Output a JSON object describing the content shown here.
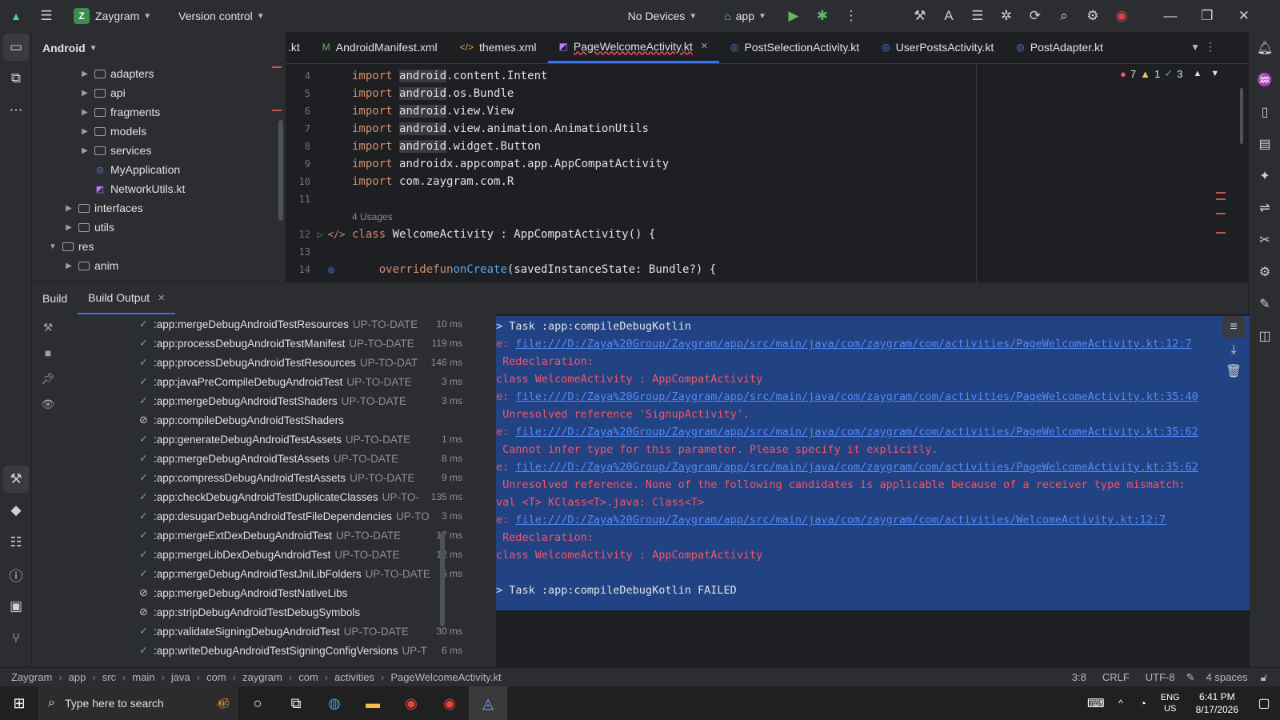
{
  "titlebar": {
    "project_letter": "Z",
    "project_name": "Zaygram",
    "vcs": "Version control",
    "devices": "No Devices",
    "run_config": "app"
  },
  "project_panel": {
    "title": "Android",
    "items": [
      {
        "label": "adapters",
        "indent": 3,
        "kind": "folder",
        "expandable": true
      },
      {
        "label": "api",
        "indent": 3,
        "kind": "folder",
        "expandable": true
      },
      {
        "label": "fragments",
        "indent": 3,
        "kind": "folder",
        "expandable": true
      },
      {
        "label": "models",
        "indent": 3,
        "kind": "folder",
        "expandable": true
      },
      {
        "label": "services",
        "indent": 3,
        "kind": "folder",
        "expandable": true
      },
      {
        "label": "MyApplication",
        "indent": 3,
        "kind": "class",
        "expandable": false
      },
      {
        "label": "NetworkUtils.kt",
        "indent": 3,
        "kind": "kotlin",
        "expandable": false
      },
      {
        "label": "interfaces",
        "indent": 2,
        "kind": "folder",
        "expandable": true
      },
      {
        "label": "utils",
        "indent": 2,
        "kind": "folder",
        "expandable": true
      },
      {
        "label": "res",
        "indent": 1,
        "kind": "folder",
        "expandable": true,
        "expanded": true
      },
      {
        "label": "anim",
        "indent": 2,
        "kind": "folder",
        "expandable": true
      }
    ]
  },
  "editor": {
    "tabs": [
      {
        "label": ".kt",
        "icon": "kotlin"
      },
      {
        "label": "AndroidManifest.xml",
        "icon": "manifest"
      },
      {
        "label": "themes.xml",
        "icon": "xml"
      },
      {
        "label": "PageWelcomeActivity.kt",
        "icon": "kotlin",
        "active": true
      },
      {
        "label": "PostSelectionActivity.kt",
        "icon": "class"
      },
      {
        "label": "UserPostsActivity.kt",
        "icon": "class"
      },
      {
        "label": "PostAdapter.kt",
        "icon": "class"
      }
    ],
    "inspection": {
      "errors": "7",
      "warnings": "1",
      "ok": "3"
    },
    "lines": [
      {
        "n": "4",
        "pre": "import ",
        "hl": "android",
        "post": ".content.Intent"
      },
      {
        "n": "5",
        "pre": "import ",
        "hl": "android",
        "post": ".os.Bundle"
      },
      {
        "n": "6",
        "pre": "import ",
        "hl": "android",
        "post": ".view.View"
      },
      {
        "n": "7",
        "pre": "import ",
        "hl": "android",
        "post": ".view.animation.AnimationUtils"
      },
      {
        "n": "8",
        "pre": "import ",
        "hl": "android",
        "post": ".widget.Button"
      },
      {
        "n": "9",
        "pre": "import ",
        "hl": "",
        "post": "androidx.appcompat.app.AppCompatActivity"
      },
      {
        "n": "10",
        "pre": "import ",
        "hl": "",
        "post": "com.zaygram.com.R"
      },
      {
        "n": "11",
        "pre": "",
        "hl": "",
        "post": ""
      }
    ],
    "usages": "4 Usages",
    "line12": {
      "n": "12",
      "kw": "class",
      "rest": " WelcomeActivity : AppCompatActivity() {"
    },
    "line13": {
      "n": "13"
    },
    "line14": {
      "n": "14",
      "kw1": "override",
      "kw2": "fun",
      "fn": "onCreate",
      "rest": "(savedInstanceState: Bundle?) {"
    }
  },
  "build_panel": {
    "tab_build": "Build",
    "tab_output": "Build Output",
    "tasks": [
      {
        "name": ":app:mergeDebugAndroidTestResources",
        "status": "UP-TO-DATE",
        "dur": "10 ms",
        "ok": true
      },
      {
        "name": ":app:processDebugAndroidTestManifest",
        "status": "UP-TO-DATE",
        "dur": "119 ms",
        "ok": true
      },
      {
        "name": ":app:processDebugAndroidTestResources",
        "status": "UP-TO-DAT",
        "dur": "146 ms",
        "ok": true
      },
      {
        "name": ":app:javaPreCompileDebugAndroidTest",
        "status": "UP-TO-DATE",
        "dur": "3 ms",
        "ok": true
      },
      {
        "name": ":app:mergeDebugAndroidTestShaders",
        "status": "UP-TO-DATE",
        "dur": "3 ms",
        "ok": true
      },
      {
        "name": ":app:compileDebugAndroidTestShaders",
        "status": "",
        "dur": "",
        "ok": false
      },
      {
        "name": ":app:generateDebugAndroidTestAssets",
        "status": "UP-TO-DATE",
        "dur": "1 ms",
        "ok": true
      },
      {
        "name": ":app:mergeDebugAndroidTestAssets",
        "status": "UP-TO-DATE",
        "dur": "8 ms",
        "ok": true
      },
      {
        "name": ":app:compressDebugAndroidTestAssets",
        "status": "UP-TO-DATE",
        "dur": "9 ms",
        "ok": true
      },
      {
        "name": ":app:checkDebugAndroidTestDuplicateClasses",
        "status": "UP-TO-",
        "dur": "135 ms",
        "ok": true
      },
      {
        "name": ":app:desugarDebugAndroidTestFileDependencies",
        "status": "UP-TO",
        "dur": "3 ms",
        "ok": true
      },
      {
        "name": ":app:mergeExtDexDebugAndroidTest",
        "status": "UP-TO-DATE",
        "dur": "17 ms",
        "ok": true
      },
      {
        "name": ":app:mergeLibDexDebugAndroidTest",
        "status": "UP-TO-DATE",
        "dur": "12 ms",
        "ok": true
      },
      {
        "name": ":app:mergeDebugAndroidTestJniLibFolders",
        "status": "UP-TO-DATE",
        "dur": "6 ms",
        "ok": true
      },
      {
        "name": ":app:mergeDebugAndroidTestNativeLibs",
        "status": "",
        "dur": "",
        "ok": false
      },
      {
        "name": ":app:stripDebugAndroidTestDebugSymbols",
        "status": "",
        "dur": "",
        "ok": false
      },
      {
        "name": ":app:validateSigningDebugAndroidTest",
        "status": "UP-TO-DATE",
        "dur": "30 ms",
        "ok": true
      },
      {
        "name": ":app:writeDebugAndroidTestSigningConfigVersions",
        "status": "UP-T",
        "dur": "6 ms",
        "ok": true
      }
    ],
    "output": [
      {
        "type": "text",
        "text": "> Task :app:compileDebugKotlin"
      },
      {
        "type": "link",
        "prefix": "e: ",
        "text": "file:///D:/Zaya%20Group/Zaygram/app/src/main/java/com/zaygram/com/activities/PageWelcomeActivity.kt:12:7"
      },
      {
        "type": "err",
        "text": " Redeclaration:"
      },
      {
        "type": "err",
        "text": "class WelcomeActivity : AppCompatActivity"
      },
      {
        "type": "link",
        "prefix": "e: ",
        "text": "file:///D:/Zaya%20Group/Zaygram/app/src/main/java/com/zaygram/com/activities/PageWelcomeActivity.kt:35:40"
      },
      {
        "type": "err",
        "text": " Unresolved reference 'SignupActivity'."
      },
      {
        "type": "link",
        "prefix": "e: ",
        "text": "file:///D:/Zaya%20Group/Zaygram/app/src/main/java/com/zaygram/com/activities/PageWelcomeActivity.kt:35:62"
      },
      {
        "type": "err",
        "text": " Cannot infer type for this parameter. Please specify it explicitly."
      },
      {
        "type": "link",
        "prefix": "e: ",
        "text": "file:///D:/Zaya%20Group/Zaygram/app/src/main/java/com/zaygram/com/activities/PageWelcomeActivity.kt:35:62"
      },
      {
        "type": "err",
        "text": " Unresolved reference. None of the following candidates is applicable because of a receiver type mismatch:"
      },
      {
        "type": "err",
        "text": "val <T> KClass<T>.java: Class<T>"
      },
      {
        "type": "link",
        "prefix": "e: ",
        "text": "file:///D:/Zaya%20Group/Zaygram/app/src/main/java/com/zaygram/com/activities/WelcomeActivity.kt:12:7"
      },
      {
        "type": "err",
        "text": " Redeclaration:"
      },
      {
        "type": "err",
        "text": "class WelcomeActivity : AppCompatActivity"
      },
      {
        "type": "text",
        "text": ""
      },
      {
        "type": "text",
        "text": "> Task :app:compileDebugKotlin FAILED"
      }
    ]
  },
  "statusbar": {
    "crumbs": [
      "Zaygram",
      "app",
      "src",
      "main",
      "java",
      "com",
      "zaygram",
      "com",
      "activities",
      "PageWelcomeActivity.kt"
    ],
    "position": "3:8",
    "line_sep": "CRLF",
    "encoding": "UTF-8",
    "indent": "4 spaces"
  },
  "taskbar": {
    "search_placeholder": "Type here to search",
    "lang1": "ENG",
    "lang2": "US",
    "time": "6:41 PM",
    "date": "8/17/2026"
  },
  "colors": {
    "accent": "#3574f0",
    "error": "#f75464",
    "link": "#548af7",
    "success": "#5fb865",
    "selection": "#214283"
  }
}
